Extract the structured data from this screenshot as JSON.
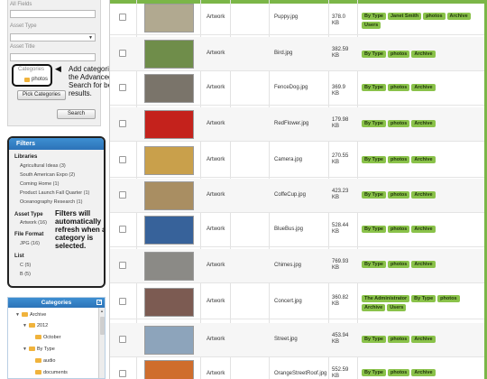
{
  "search": {
    "all_fields_label": "All Fields",
    "asset_type_label": "Asset Type",
    "asset_title_label": "Asset Title",
    "categories_label": "Categories",
    "category_value": "photos",
    "callout": "Add categories to the Advanced Search for best results.",
    "pick_categories_button": "Pick Categories",
    "search_button": "Search"
  },
  "filters": {
    "title": "Filters",
    "libraries_heading": "Libraries",
    "libraries": [
      "Agricultural Ideas (3)",
      "South American Expo (2)",
      "Coming Home (1)",
      "Product Launch Fall Quarter (1)",
      "Oceanography Research (1)"
    ],
    "asset_type_heading": "Asset Type",
    "asset_types": [
      "Artwork (16)"
    ],
    "file_format_heading": "File Format",
    "file_formats": [
      "JPG (16)"
    ],
    "list_heading": "List",
    "lists": [
      "C (5)",
      "B (5)"
    ],
    "note": "Filters will automatically refresh when a category is selected."
  },
  "categories_panel": {
    "title": "Categories",
    "tree": [
      "Archive",
      "2012",
      "October",
      "By Type",
      "audio",
      "documents"
    ]
  },
  "colors": {
    "tag_green": "#8ac24a",
    "header_blue": "#2c73b8",
    "grid_accent": "#7bb648",
    "folder": "#f0b33c"
  },
  "assets": [
    {
      "type": "Artwork",
      "name": "Puppy.jpg",
      "size": "378.0 KB",
      "tags": [
        "By Type",
        "Janet Smith",
        "photos",
        "Archive",
        "Users"
      ],
      "thumb": "#b1a990"
    },
    {
      "type": "Artwork",
      "name": "Bird.jpg",
      "size": "382.59 KB",
      "tags": [
        "By Type",
        "photos",
        "Archive"
      ],
      "thumb": "#6f8d4a"
    },
    {
      "type": "Artwork",
      "name": "FenceDog.jpg",
      "size": "369.9 KB",
      "tags": [
        "By Type",
        "photos",
        "Archive"
      ],
      "thumb": "#7a746a"
    },
    {
      "type": "Artwork",
      "name": "RedFlower.jpg",
      "size": "179.98 KB",
      "tags": [
        "By Type",
        "photos",
        "Archive"
      ],
      "thumb": "#c4221c"
    },
    {
      "type": "Artwork",
      "name": "Camera.jpg",
      "size": "270.55 KB",
      "tags": [
        "By Type",
        "photos",
        "Archive"
      ],
      "thumb": "#c9a04b"
    },
    {
      "type": "Artwork",
      "name": "CoffeCup.jpg",
      "size": "423.23 KB",
      "tags": [
        "By Type",
        "photos",
        "Archive"
      ],
      "thumb": "#a98e62"
    },
    {
      "type": "Artwork",
      "name": "BlueBus.jpg",
      "size": "528.44 KB",
      "tags": [
        "By Type",
        "photos",
        "Archive"
      ],
      "thumb": "#37629a"
    },
    {
      "type": "Artwork",
      "name": "Chimes.jpg",
      "size": "769.93 KB",
      "tags": [
        "By Type",
        "photos",
        "Archive"
      ],
      "thumb": "#8b8a86"
    },
    {
      "type": "Artwork",
      "name": "Concert.jpg",
      "size": "360.82 KB",
      "tags": [
        "The Administrator",
        "By Type",
        "photos",
        "Archive",
        "Users"
      ],
      "thumb": "#7c5b52"
    },
    {
      "type": "Artwork",
      "name": "Street.jpg",
      "size": "453.94 KB",
      "tags": [
        "By Type",
        "photos",
        "Archive"
      ],
      "thumb": "#8da4bb"
    },
    {
      "type": "Artwork",
      "name": "OrangeStreetRoof.jpg",
      "size": "552.59 KB",
      "tags": [
        "By Type",
        "photos",
        "Archive"
      ],
      "thumb": "#cf6d2c"
    }
  ]
}
